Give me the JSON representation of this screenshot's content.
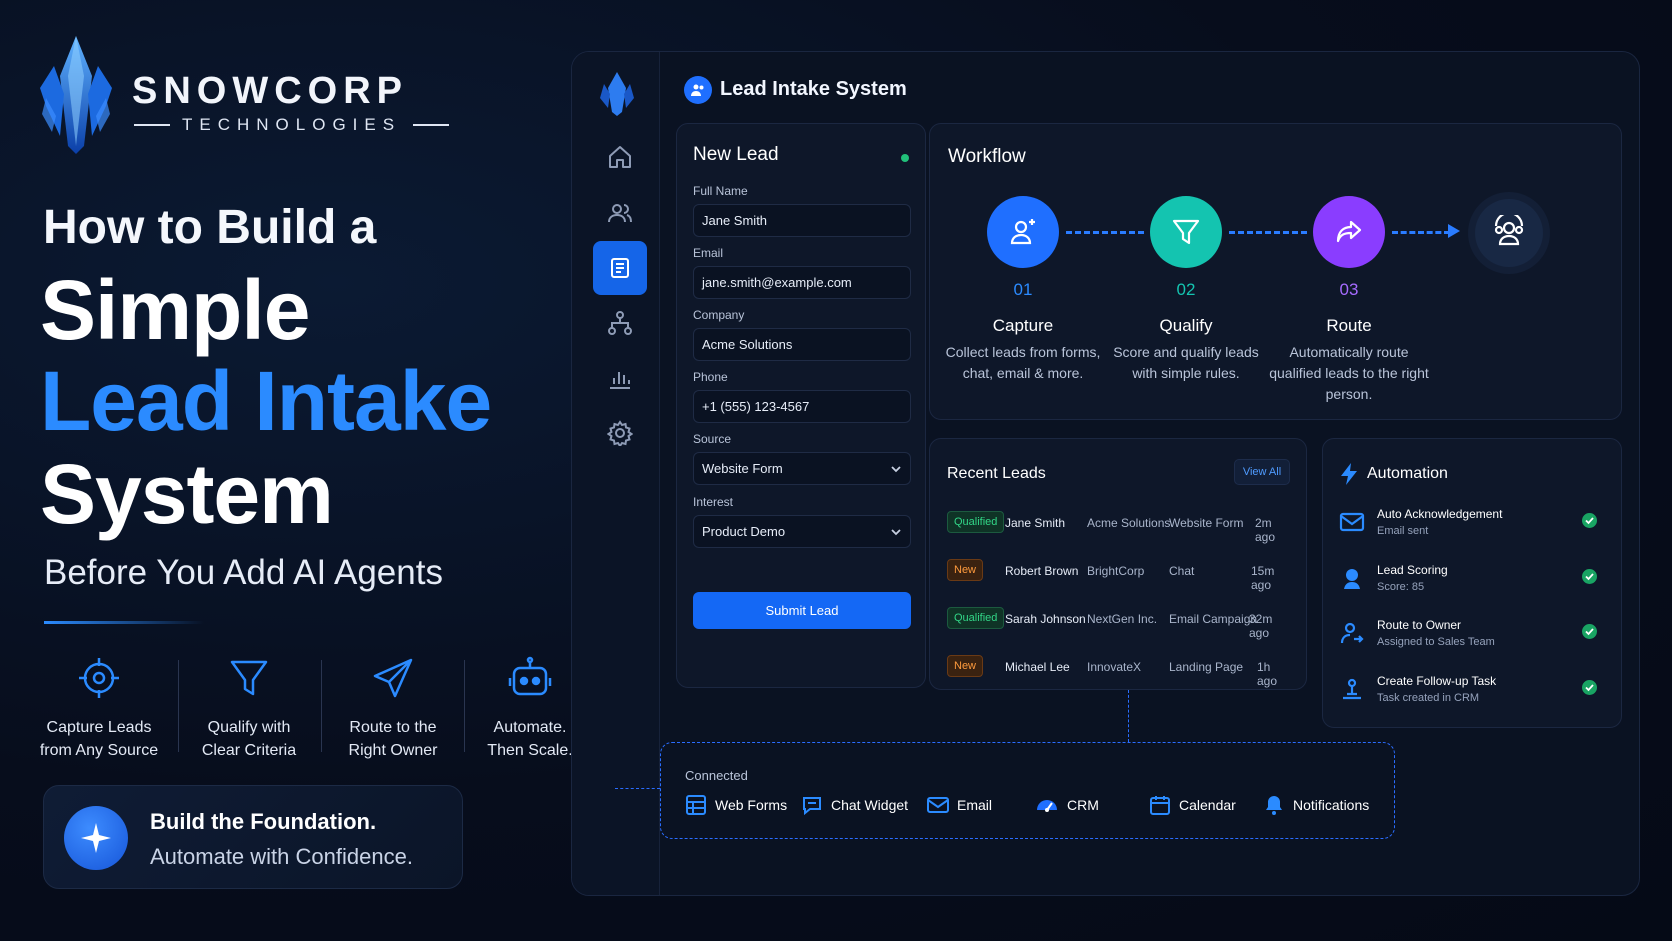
{
  "brand": {
    "name": "SNOWCORP",
    "tagline": "TECHNOLOGIES"
  },
  "hero": {
    "line1": "How to Build a",
    "line2": "Simple",
    "line3": "Lead Intake",
    "line4": "System",
    "subtitle": "Before You Add AI Agents"
  },
  "features": [
    {
      "icon": "target-icon",
      "label": "Capture Leads\nfrom Any Source"
    },
    {
      "icon": "filter-icon",
      "label": "Qualify with\nClear Criteria"
    },
    {
      "icon": "send-icon",
      "label": "Route to the\nRight Owner"
    },
    {
      "icon": "robot-icon",
      "label": "Automate.\nThen Scale."
    }
  ],
  "cta": {
    "line1": "Build the Foundation.",
    "line2": "Automate with Confidence."
  },
  "app": {
    "title": "Lead Intake System",
    "new_lead": {
      "title": "New Lead",
      "full_name_label": "Full Name",
      "full_name_value": "Jane Smith",
      "email_label": "Email",
      "email_value": "jane.smith@example.com",
      "company_label": "Company",
      "company_value": "Acme Solutions",
      "phone_label": "Phone",
      "phone_value": "+1 (555) 123-4567",
      "source_label": "Source",
      "source_value": "Website Form",
      "interest_label": "Interest",
      "interest_value": "Product Demo",
      "submit_label": "Submit Lead"
    },
    "workflow": {
      "title": "Workflow",
      "steps": [
        {
          "num": "01",
          "name": "Capture",
          "desc": "Collect leads from forms, chat, email & more.",
          "color": "#1f6fff"
        },
        {
          "num": "02",
          "name": "Qualify",
          "desc": "Score and qualify leads with simple rules.",
          "color": "#14c4b0"
        },
        {
          "num": "03",
          "name": "Route",
          "desc": "Automatically route qualified leads to the right person.",
          "color": "#8a3dff"
        }
      ]
    },
    "recent_leads": {
      "title": "Recent Leads",
      "view_all": "View All",
      "rows": [
        {
          "status": "Qualified",
          "name": "Jane Smith",
          "company": "Acme Solutions",
          "source": "Website Form",
          "time": "2m ago"
        },
        {
          "status": "New",
          "name": "Robert Brown",
          "company": "BrightCorp",
          "source": "Chat",
          "time": "15m ago"
        },
        {
          "status": "Qualified",
          "name": "Sarah Johnson",
          "company": "NextGen Inc.",
          "source": "Email Campaign",
          "time": "32m ago"
        },
        {
          "status": "New",
          "name": "Michael Lee",
          "company": "InnovateX",
          "source": "Landing Page",
          "time": "1h ago"
        }
      ]
    },
    "automation": {
      "title": "Automation",
      "items": [
        {
          "name": "Auto Acknowledgement",
          "sub": "Email sent",
          "icon": "mail-icon"
        },
        {
          "name": "Lead Scoring",
          "sub": "Score: 85",
          "icon": "score-icon"
        },
        {
          "name": "Route to Owner",
          "sub": "Assigned to Sales Team",
          "icon": "user-route-icon"
        },
        {
          "name": "Create Follow-up Task",
          "sub": "Task created in CRM",
          "icon": "task-icon"
        }
      ]
    },
    "connected": {
      "title": "Connected",
      "items": [
        "Web Forms",
        "Chat Widget",
        "Email",
        "CRM",
        "Calendar",
        "Notifications"
      ]
    }
  }
}
